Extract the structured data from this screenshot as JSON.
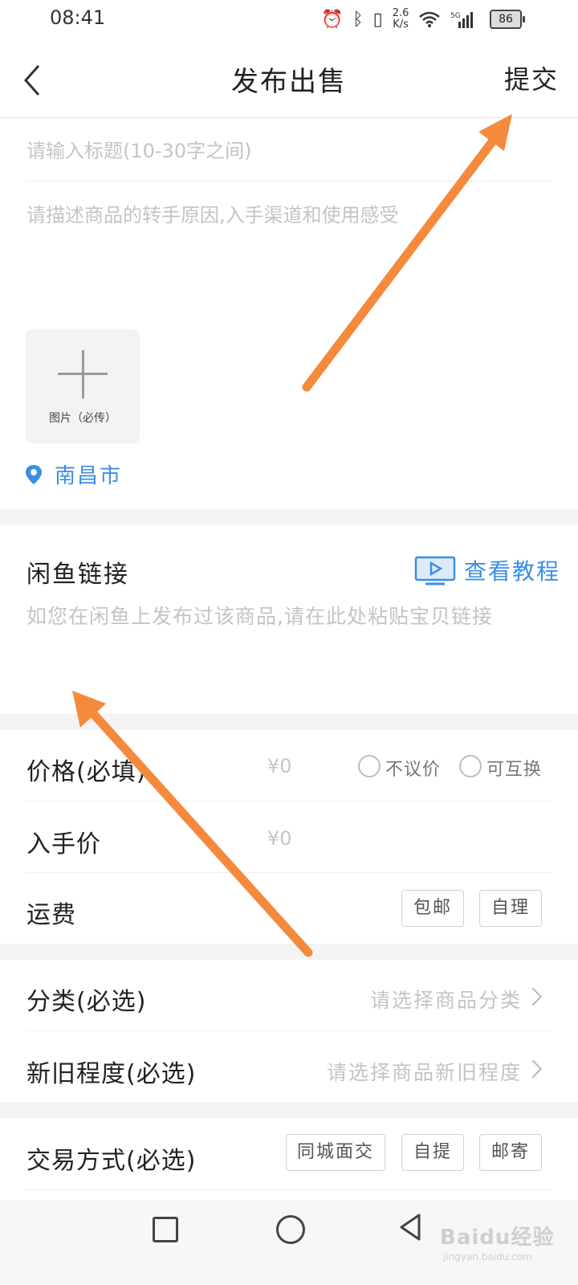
{
  "status_bar": {
    "time": "08:41",
    "net_speed_top": "2.6",
    "net_speed_bottom": "K/s",
    "battery": "86"
  },
  "nav": {
    "title": "发布出售",
    "submit_label": "提交"
  },
  "form": {
    "title_placeholder": "请输入标题(10-30字之间)",
    "desc_placeholder": "请描述商品的转手原因,入手渠道和使用感受",
    "upload_label": "图片（必传）",
    "location": "南昌市"
  },
  "xianyu": {
    "title": "闲鱼链接",
    "tutorial": "查看教程",
    "placeholder": "如您在闲鱼上发布过该商品,请在此处粘贴宝贝链接"
  },
  "pricing": {
    "price_label": "价格(必填)",
    "price_value": "¥0",
    "no_bargain": "不议价",
    "exchangeable": "可互换",
    "cost_label": "入手价",
    "cost_value": "¥0",
    "shipping_label": "运费",
    "free_shipping": "包邮",
    "self_pay": "自理"
  },
  "category": {
    "label": "分类(必选)",
    "hint": "请选择商品分类",
    "condition_label": "新旧程度(必选)",
    "condition_hint": "请选择商品新旧程度"
  },
  "trade": {
    "label": "交易方式(必选)",
    "options": [
      "同城面交",
      "自提",
      "邮寄"
    ]
  },
  "watermark": {
    "brand": "Baidu经验",
    "url": "jingyan.baidu.com"
  },
  "colors": {
    "accent": "#3a8ee6",
    "annotation_arrow": "#f58a3c"
  }
}
